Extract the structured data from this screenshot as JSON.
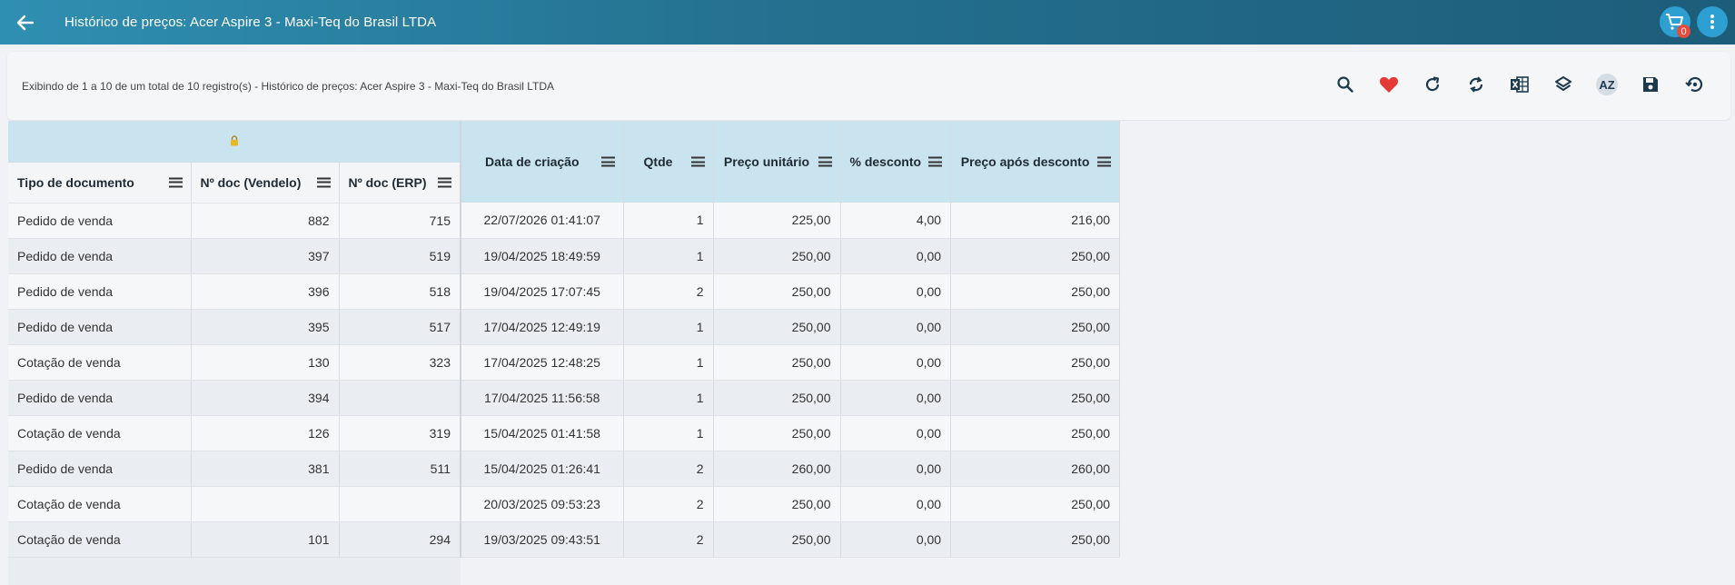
{
  "header": {
    "title": "Histórico de preços: Acer Aspire 3 - Maxi-Teq do Brasil LTDA",
    "cart_count": "0"
  },
  "info_text": "Exibindo de 1 a 10 de um total de 10 registro(s) - Histórico de preços: Acer Aspire 3 - Maxi-Teq do Brasil LTDA",
  "toolbar": [
    "search-icon",
    "favorite-heart-icon",
    "refresh-icon",
    "sync-icon",
    "excel-export-icon",
    "layers-icon",
    "sort-az-icon",
    "save-icon",
    "restore-icon"
  ],
  "table": {
    "columns": [
      "Tipo de documento",
      "Nº doc (Vendelo)",
      "Nº doc (ERP)",
      "Data de criação",
      "Qtde",
      "Preço unitário",
      "% desconto",
      "Preço após desconto"
    ],
    "rows": [
      [
        "Pedido de venda",
        "882",
        "715",
        "22/07/2026 01:41:07",
        "1",
        "225,00",
        "4,00",
        "216,00"
      ],
      [
        "Pedido de venda",
        "397",
        "519",
        "19/04/2025 18:49:59",
        "1",
        "250,00",
        "0,00",
        "250,00"
      ],
      [
        "Pedido de venda",
        "396",
        "518",
        "19/04/2025 17:07:45",
        "2",
        "250,00",
        "0,00",
        "250,00"
      ],
      [
        "Pedido de venda",
        "395",
        "517",
        "17/04/2025 12:49:19",
        "1",
        "250,00",
        "0,00",
        "250,00"
      ],
      [
        "Cotação de venda",
        "130",
        "323",
        "17/04/2025 12:48:25",
        "1",
        "250,00",
        "0,00",
        "250,00"
      ],
      [
        "Pedido de venda",
        "394",
        "",
        "17/04/2025 11:56:58",
        "1",
        "250,00",
        "0,00",
        "250,00"
      ],
      [
        "Cotação de venda",
        "126",
        "319",
        "15/04/2025 01:41:58",
        "1",
        "250,00",
        "0,00",
        "250,00"
      ],
      [
        "Pedido de venda",
        "381",
        "511",
        "15/04/2025 01:26:41",
        "2",
        "260,00",
        "0,00",
        "260,00"
      ],
      [
        "Cotação de venda",
        "",
        "",
        "20/03/2025 09:53:23",
        "2",
        "250,00",
        "0,00",
        "250,00"
      ],
      [
        "Cotação de venda",
        "101",
        "294",
        "19/03/2025 09:43:51",
        "2",
        "250,00",
        "0,00",
        "250,00"
      ]
    ]
  },
  "colors": {
    "topbar": "#24708f",
    "group_header": "#c9e3ef",
    "accent": "#2d9fd0",
    "heart": "#e53935"
  }
}
